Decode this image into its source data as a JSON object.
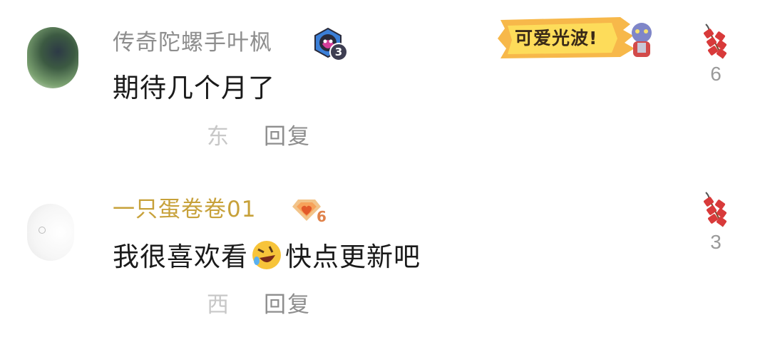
{
  "comments": [
    {
      "username": "传奇陀螺手叶枫",
      "badge_level": "3",
      "content": "期待几个月了",
      "location": "东",
      "reply_label": "回复",
      "like_count": "6",
      "sticker_text": "可爱光波!",
      "badge_icon": "purple-hat-medal-icon"
    },
    {
      "username": "一只蛋卷卷01",
      "badge_level": "6",
      "content_before": "我很喜欢看",
      "content_emoji": "rolling-laughing-emoji",
      "content_after": "快点更新吧",
      "location": "西",
      "reply_label": "回复",
      "like_count": "3",
      "badge_icon": "orange-heart-diamond-icon"
    }
  ],
  "colors": {
    "username_normal": "#8e8e8e",
    "username_gold": "#c7a13a",
    "content": "#1a1a1a",
    "meta": "#9a9a9a",
    "like_icon": "#d83a3a"
  },
  "like_icon": "firecracker-icon"
}
